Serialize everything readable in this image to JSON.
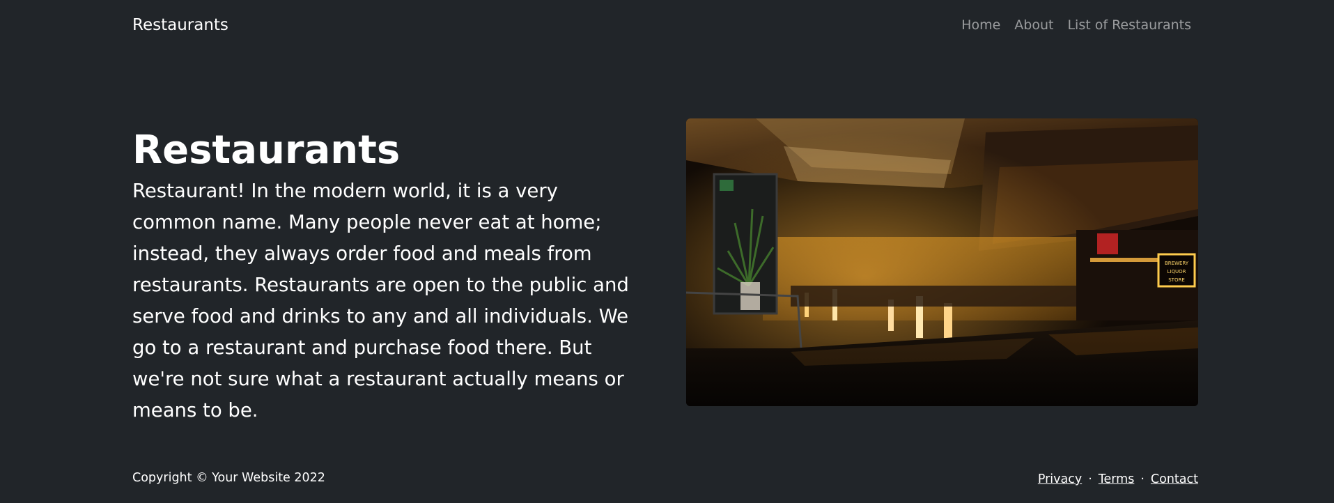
{
  "navbar": {
    "brand": "Restaurants",
    "links": [
      "Home",
      "About",
      "List of Restaurants"
    ]
  },
  "hero": {
    "title": "Restaurants",
    "body": "Restaurant! In the modern world, it is a very common name. Many people never eat at home; instead, they always order food and meals from restaurants. Restaurants are open to the public and serve food and drinks to any and all individuals. We go to a restaurant and purchase food there. But we're not sure what a restaurant actually means or means to be.",
    "image_signs": {
      "brewery": "BREWERY",
      "liquor": "LIQUOR",
      "store": "STORE"
    }
  },
  "footer": {
    "copyright": "Copyright © Your Website 2022",
    "links": [
      "Privacy",
      "Terms",
      "Contact"
    ],
    "separator": "·"
  },
  "colors": {
    "background": "#212529",
    "text": "#ffffff",
    "nav_link": "rgba(255,255,255,0.55)"
  }
}
